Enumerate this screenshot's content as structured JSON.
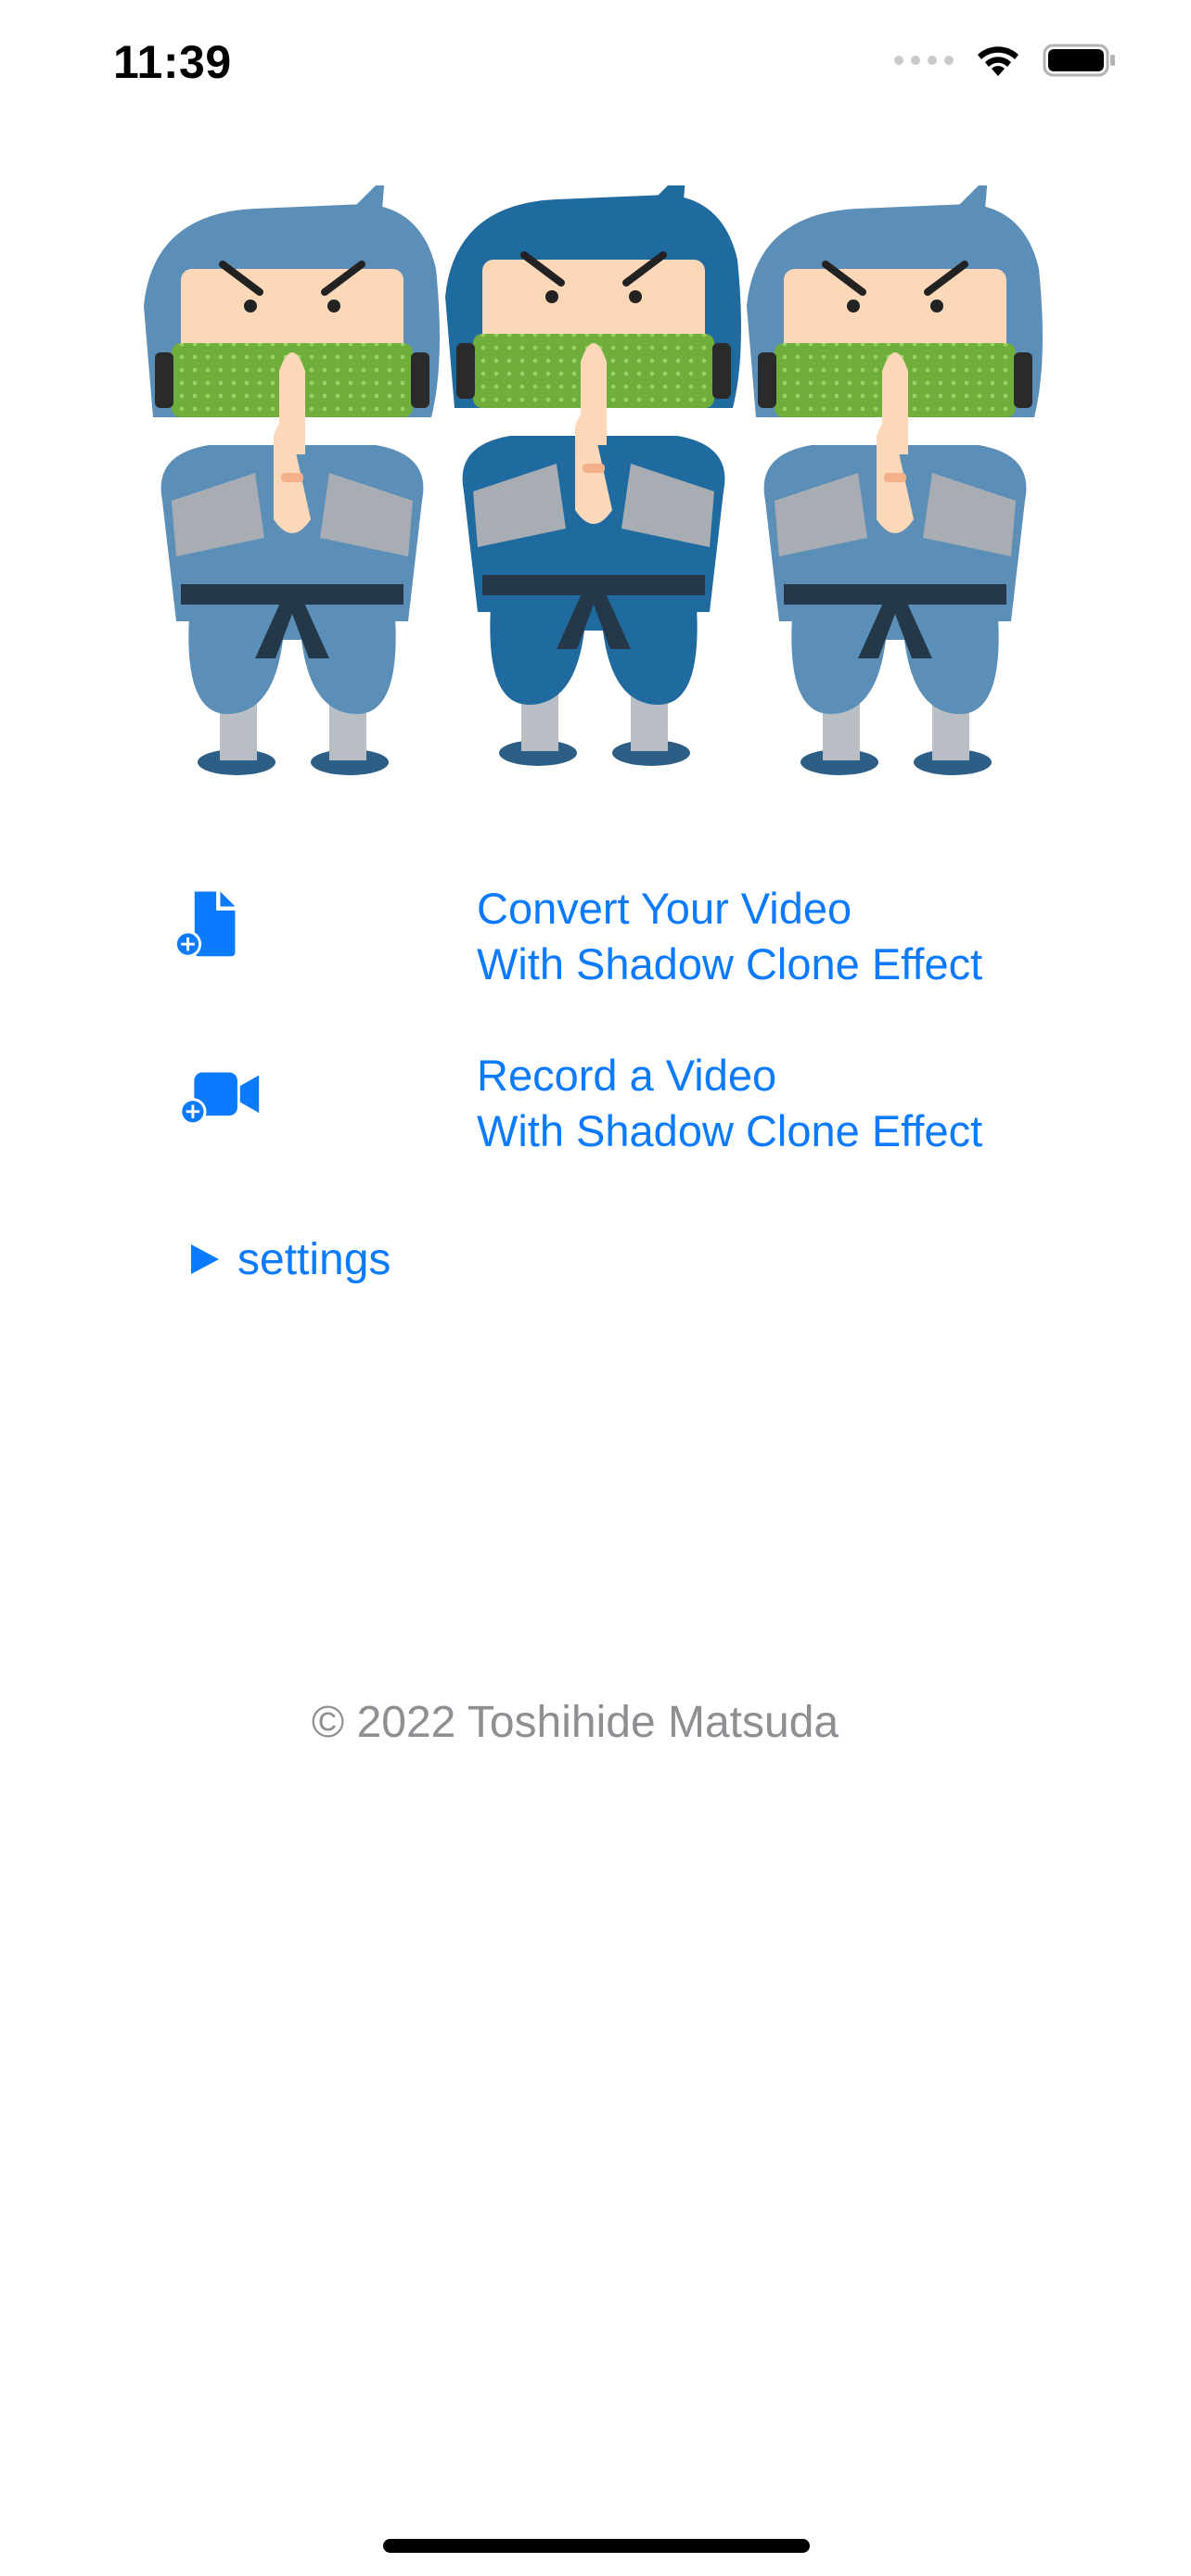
{
  "status_bar": {
    "time": "11:39",
    "icons": [
      "cellular-signal-icon",
      "wifi-icon",
      "battery-icon"
    ]
  },
  "hero": {
    "image": "three-ninja-illustration",
    "colors": {
      "left_ninja": "#5b8fb8",
      "center_ninja": "#1f6a9e",
      "right_ninja": "#5b8fb8",
      "mask": "#6fae3a",
      "skin": "#fcd7b8"
    }
  },
  "actions": [
    {
      "icon": "document-add-icon",
      "line1": "Convert Your Video",
      "line2": "With Shadow Clone Effect"
    },
    {
      "icon": "video-camera-add-icon",
      "line1": "Record a Video",
      "line2": "With Shadow Clone Effect"
    }
  ],
  "settings": {
    "icon": "disclosure-triangle-icon",
    "label": "settings"
  },
  "footer": {
    "copyright": "© 2022 Toshihide Matsuda"
  },
  "colors": {
    "accent": "#0a7aff",
    "secondary_text": "#8e8e93"
  }
}
